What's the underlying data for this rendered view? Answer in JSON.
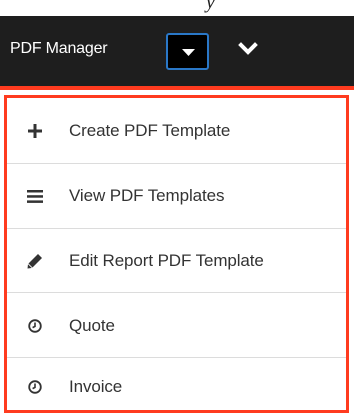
{
  "caption_fragment": "y",
  "navbar": {
    "title": "PDF Manager",
    "caret_icon": "caret-down-icon",
    "chevron_icon": "chevron-down-icon"
  },
  "menu": {
    "items": [
      {
        "label": "Create PDF Template",
        "icon": "plus-icon"
      },
      {
        "label": "View PDF Templates",
        "icon": "list-icon"
      },
      {
        "label": "Edit Report PDF Template",
        "icon": "pencil-icon"
      },
      {
        "label": "Quote",
        "icon": "clock-icon"
      },
      {
        "label": "Invoice",
        "icon": "clock-icon"
      }
    ]
  },
  "colors": {
    "navbar_bg": "#1e1e1e",
    "highlight_border": "#ff3b1f",
    "caret_focus": "#2a78c8"
  }
}
